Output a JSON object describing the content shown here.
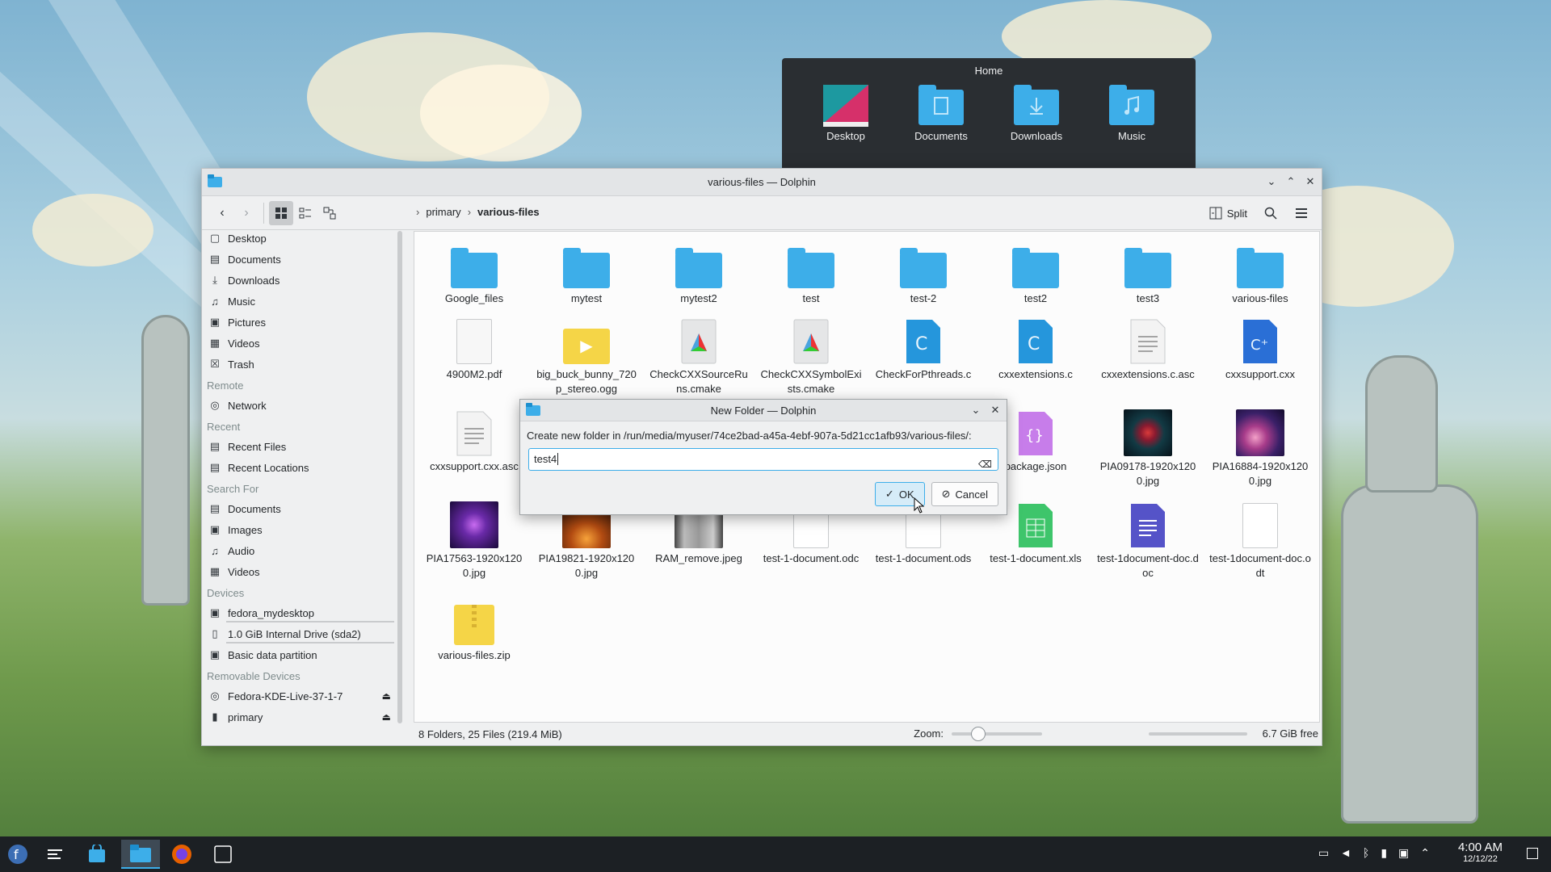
{
  "home_popup": {
    "title": "Home",
    "items": [
      {
        "label": "Desktop",
        "icon": "desktop-folder-icon"
      },
      {
        "label": "Documents",
        "icon": "documents-folder-icon"
      },
      {
        "label": "Downloads",
        "icon": "downloads-folder-icon"
      },
      {
        "label": "Music",
        "icon": "music-folder-icon"
      }
    ]
  },
  "window": {
    "title": "various-files — Dolphin",
    "breadcrumb": [
      "primary",
      "various-files"
    ],
    "split_label": "Split"
  },
  "sidebar": {
    "places": [
      {
        "label": "Desktop",
        "icon": "desktop-icon"
      },
      {
        "label": "Documents",
        "icon": "documents-icon"
      },
      {
        "label": "Downloads",
        "icon": "downloads-icon"
      },
      {
        "label": "Music",
        "icon": "music-icon"
      },
      {
        "label": "Pictures",
        "icon": "pictures-icon"
      },
      {
        "label": "Videos",
        "icon": "videos-icon"
      },
      {
        "label": "Trash",
        "icon": "trash-icon"
      }
    ],
    "remote_header": "Remote",
    "remote": [
      {
        "label": "Network",
        "icon": "network-icon"
      }
    ],
    "recent_header": "Recent",
    "recent": [
      {
        "label": "Recent Files",
        "icon": "recent-files-icon"
      },
      {
        "label": "Recent Locations",
        "icon": "recent-locations-icon"
      }
    ],
    "search_header": "Search For",
    "search": [
      {
        "label": "Documents",
        "icon": "documents-icon"
      },
      {
        "label": "Images",
        "icon": "images-icon"
      },
      {
        "label": "Audio",
        "icon": "audio-icon"
      },
      {
        "label": "Videos",
        "icon": "videos-icon"
      }
    ],
    "devices_header": "Devices",
    "devices": [
      {
        "label": "fedora_mydesktop",
        "icon": "drive-icon"
      },
      {
        "label": "1.0 GiB Internal Drive (sda2)",
        "icon": "drive-icon"
      },
      {
        "label": "Basic data partition",
        "icon": "drive-icon"
      }
    ],
    "removable_header": "Removable Devices",
    "removable": [
      {
        "label": "Fedora-KDE-Live-37-1-7",
        "icon": "optical-disc-icon"
      },
      {
        "label": "primary",
        "icon": "usb-drive-icon"
      }
    ]
  },
  "files": [
    {
      "name": "Google_files",
      "kind": "folder"
    },
    {
      "name": "mytest",
      "kind": "folder"
    },
    {
      "name": "mytest2",
      "kind": "folder"
    },
    {
      "name": "test",
      "kind": "folder"
    },
    {
      "name": "test-2",
      "kind": "folder"
    },
    {
      "name": "test2",
      "kind": "folder"
    },
    {
      "name": "test3",
      "kind": "folder"
    },
    {
      "name": "various-files",
      "kind": "folder"
    },
    {
      "name": "4900M2.pdf",
      "kind": "pdf"
    },
    {
      "name": "big_buck_bunny_720p_stereo.ogg",
      "kind": "video"
    },
    {
      "name": "CheckCXXSourceRuns.cmake",
      "kind": "cmake"
    },
    {
      "name": "CheckCXXSymbolExists.cmake",
      "kind": "cmake"
    },
    {
      "name": "CheckForPthreads.c",
      "kind": "c"
    },
    {
      "name": "cxxextensions.c",
      "kind": "c"
    },
    {
      "name": "cxxextensions.c.asc",
      "kind": "text"
    },
    {
      "name": "cxxsupport.cxx",
      "kind": "cpp"
    },
    {
      "name": "cxxsupport.cxx.asc",
      "kind": "text"
    },
    {
      "name": "package.json",
      "kind": "json"
    },
    {
      "name": "PIA09178-1920x1200.jpg",
      "kind": "image-red"
    },
    {
      "name": "PIA16884-1920x1200.jpg",
      "kind": "image-galaxy"
    },
    {
      "name": "PIA17563-1920x1200.jpg",
      "kind": "image-purple"
    },
    {
      "name": "PIA19821-1920x1200.jpg",
      "kind": "image-orange"
    },
    {
      "name": "RAM_remove.jpeg",
      "kind": "image-grey"
    },
    {
      "name": "test-1-document.odc",
      "kind": "doc"
    },
    {
      "name": "test-1-document.ods",
      "kind": "doc"
    },
    {
      "name": "test-1-document.xls",
      "kind": "xls"
    },
    {
      "name": "test-1document-doc.doc",
      "kind": "word"
    },
    {
      "name": "test-1document-doc.odt",
      "kind": "doc"
    },
    {
      "name": "various-files.zip",
      "kind": "zip"
    }
  ],
  "status": {
    "summary": "8 Folders, 25 Files (219.4 MiB)",
    "zoom_label": "Zoom:",
    "free": "6.7 GiB free"
  },
  "dialog": {
    "title": "New Folder — Dolphin",
    "prompt": "Create new folder in /run/media/myuser/74ce2bad-a45a-4ebf-907a-5d21cc1afb93/various-files/:",
    "value": "test4",
    "ok_label": "OK",
    "cancel_label": "Cancel"
  },
  "taskbar": {
    "time": "4:00 AM",
    "date": "12/12/22"
  },
  "colors": {
    "accent": "#3daee9",
    "window_bg": "#eff0f1",
    "taskbar_bg": "#1c2024"
  }
}
